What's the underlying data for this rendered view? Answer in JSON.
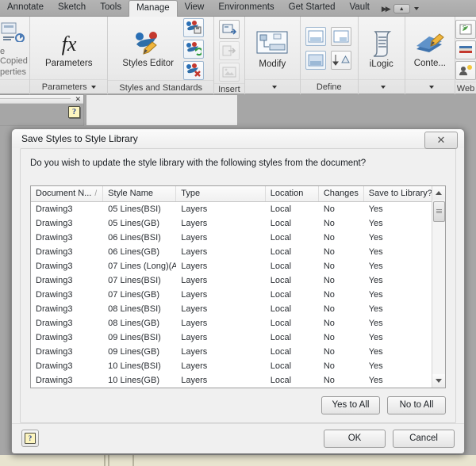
{
  "ribbon": {
    "tabs": [
      {
        "label": "Annotate",
        "active": false
      },
      {
        "label": "Sketch",
        "active": false
      },
      {
        "label": "Tools",
        "active": false
      },
      {
        "label": "Manage",
        "active": true
      },
      {
        "label": "View",
        "active": false
      },
      {
        "label": "Environments",
        "active": false
      },
      {
        "label": "Get Started",
        "active": false
      },
      {
        "label": "Vault",
        "active": false
      }
    ],
    "overflow_icon": "double-chevron-right-icon",
    "minimize_icon": "minimize-ribbon-icon",
    "panels": [
      {
        "name": "clipboard",
        "label": "",
        "buttons": [
          {
            "label": "e Copied",
            "icon": "paste-copied-icon"
          },
          {
            "label": "perties",
            "icon": "properties-icon"
          }
        ]
      },
      {
        "name": "parameters",
        "label": "Parameters",
        "has_dropdown": true,
        "buttons": [
          {
            "label": "Parameters",
            "icon": "fx-parameters-icon"
          }
        ]
      },
      {
        "name": "styles-and-standards",
        "label": "Styles and Standards",
        "has_dropdown": false,
        "buttons": [
          {
            "label": "Styles Editor",
            "icon": "styles-editor-icon"
          },
          {
            "label": "",
            "icon": "save-styles-icon"
          },
          {
            "label": "",
            "icon": "update-styles-icon"
          },
          {
            "label": "",
            "icon": "purge-styles-icon"
          }
        ]
      },
      {
        "name": "insert",
        "label": "Insert",
        "has_dropdown": false,
        "buttons": [
          {
            "label": "",
            "icon": "insert-object-icon"
          },
          {
            "label": "",
            "icon": "import-icon"
          },
          {
            "label": "",
            "icon": "insert-image-icon"
          }
        ]
      },
      {
        "name": "modify",
        "label": "",
        "has_dropdown": true,
        "buttons": [
          {
            "label": "Modify",
            "icon": "modify-icon"
          }
        ]
      },
      {
        "name": "define",
        "label": "Define",
        "has_dropdown": false,
        "buttons": [
          {
            "label": "",
            "icon": "define-top-left-icon"
          },
          {
            "label": "",
            "icon": "define-top-right-icon"
          },
          {
            "label": "",
            "icon": "define-bottom-left-icon"
          },
          {
            "label": "",
            "icon": "define-sort-icon"
          }
        ]
      },
      {
        "name": "ilogic",
        "label": "",
        "has_dropdown": true,
        "buttons": [
          {
            "label": "iLogic",
            "icon": "ilogic-scroll-icon"
          }
        ]
      },
      {
        "name": "content-center",
        "label": "",
        "has_dropdown": true,
        "buttons": [
          {
            "label": "Conte...",
            "icon": "content-center-icon"
          }
        ]
      },
      {
        "name": "web",
        "label": "Web",
        "has_dropdown": false,
        "buttons": [
          {
            "label": "",
            "icon": "suite-workflows-icon"
          },
          {
            "label": "books-icon",
            "icon": "books-icon"
          },
          {
            "label": "",
            "icon": "user-idea-icon"
          }
        ]
      }
    ]
  },
  "background_panel": {
    "close_icon": "close-icon",
    "help_icon": "help-question-icon"
  },
  "dialog": {
    "title": "Save Styles to Style Library",
    "close_label": "✕",
    "close_icon": "close-icon",
    "prompt": "Do you wish to update the style library with the following styles from the document?",
    "table": {
      "columns": [
        {
          "label": "Document N...",
          "sorted": true,
          "sort_glyph": "/"
        },
        {
          "label": "Style Name",
          "sorted": false,
          "sort_glyph": ""
        },
        {
          "label": "Type",
          "sorted": false,
          "sort_glyph": ""
        },
        {
          "label": "Location",
          "sorted": false,
          "sort_glyph": ""
        },
        {
          "label": "Changes",
          "sorted": false,
          "sort_glyph": ""
        },
        {
          "label": "Save to Library?",
          "sorted": false,
          "sort_glyph": ""
        }
      ],
      "rows": [
        [
          "Drawing3",
          "05 Lines(BSI)",
          "Layers",
          "Local",
          "No",
          "Yes"
        ],
        [
          "Drawing3",
          "05 Lines(GB)",
          "Layers",
          "Local",
          "No",
          "Yes"
        ],
        [
          "Drawing3",
          "06 Lines(BSI)",
          "Layers",
          "Local",
          "No",
          "Yes"
        ],
        [
          "Drawing3",
          "06 Lines(GB)",
          "Layers",
          "Local",
          "No",
          "Yes"
        ],
        [
          "Drawing3",
          "07 Lines (Long)(A...",
          "Layers",
          "Local",
          "No",
          "Yes"
        ],
        [
          "Drawing3",
          "07 Lines(BSI)",
          "Layers",
          "Local",
          "No",
          "Yes"
        ],
        [
          "Drawing3",
          "07 Lines(GB)",
          "Layers",
          "Local",
          "No",
          "Yes"
        ],
        [
          "Drawing3",
          "08 Lines(BSI)",
          "Layers",
          "Local",
          "No",
          "Yes"
        ],
        [
          "Drawing3",
          "08 Lines(GB)",
          "Layers",
          "Local",
          "No",
          "Yes"
        ],
        [
          "Drawing3",
          "09 Lines(BSI)",
          "Layers",
          "Local",
          "No",
          "Yes"
        ],
        [
          "Drawing3",
          "09 Lines(GB)",
          "Layers",
          "Local",
          "No",
          "Yes"
        ],
        [
          "Drawing3",
          "10 Lines(BSI)",
          "Layers",
          "Local",
          "No",
          "Yes"
        ],
        [
          "Drawing3",
          "10 Lines(GB)",
          "Layers",
          "Local",
          "No",
          "Yes"
        ]
      ],
      "scrollbar": {
        "up_icon": "scroll-up-arrow-icon",
        "down_icon": "scroll-down-arrow-icon",
        "thumb_position": "top"
      }
    },
    "buttons": {
      "yes_to_all": "Yes to All",
      "no_to_all": "No to All",
      "ok": "OK",
      "cancel": "Cancel"
    },
    "help_icon": "help-question-icon"
  },
  "colors": {
    "desktop_background": "#a6a6a6",
    "dialog_face": "#f0f0f0",
    "ribbon_tab_bar": "#adadad",
    "accent_blue": "#3a6ea5",
    "help_yellow": "#fdf5bf",
    "bottom_strip": "#e8e4cf"
  }
}
